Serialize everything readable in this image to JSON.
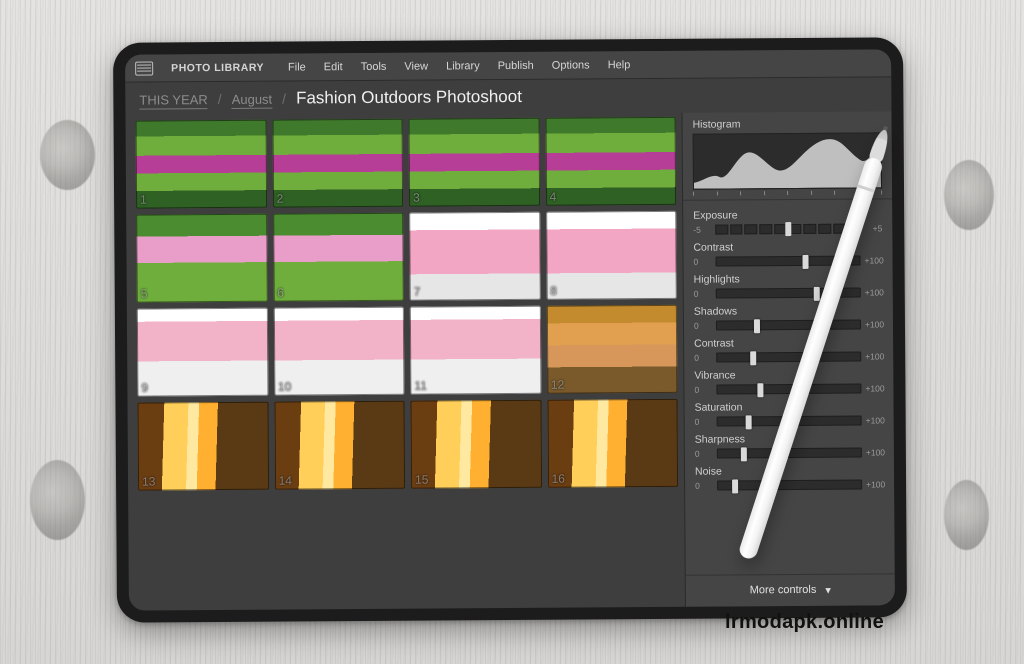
{
  "watermark": "lrmodapk.online",
  "app": {
    "name": "PHOTO LIBRARY"
  },
  "menu": {
    "file": "File",
    "edit": "Edit",
    "tools": "Tools",
    "view": "View",
    "library": "Library",
    "publish": "Publish",
    "options": "Options",
    "help": "Help"
  },
  "breadcrumb": {
    "root": "THIS YEAR",
    "mid": "August",
    "title": "Fashion Outdoors Photoshoot"
  },
  "thumbs": {
    "n1": "1",
    "n2": "2",
    "n3": "3",
    "n4": "4",
    "n5": "5",
    "n6": "6",
    "n7": "7",
    "n8": "8",
    "n9": "9",
    "n10": "10",
    "n11": "11",
    "n12": "12",
    "n13": "13",
    "n14": "14",
    "n15": "15",
    "n16": "16"
  },
  "panel": {
    "histogram_label": "Histogram",
    "more_label": "More controls",
    "sliders": {
      "exposure": {
        "label": "Exposure",
        "min": "-5",
        "max": "+5",
        "pos": 50
      },
      "contrast1": {
        "label": "Contrast",
        "min": "0",
        "max": "+100",
        "pos": 62
      },
      "highlights": {
        "label": "Highlights",
        "min": "0",
        "max": "+100",
        "pos": 70
      },
      "shadows": {
        "label": "Shadows",
        "min": "0",
        "max": "+100",
        "pos": 28
      },
      "contrast2": {
        "label": "Contrast",
        "min": "0",
        "max": "+100",
        "pos": 25
      },
      "vibrance": {
        "label": "Vibrance",
        "min": "0",
        "max": "+100",
        "pos": 30
      },
      "saturation": {
        "label": "Saturation",
        "min": "0",
        "max": "+100",
        "pos": 22
      },
      "sharpness": {
        "label": "Sharpness",
        "min": "0",
        "max": "+100",
        "pos": 18
      },
      "noise": {
        "label": "Noise",
        "min": "0",
        "max": "+100",
        "pos": 12
      }
    }
  }
}
